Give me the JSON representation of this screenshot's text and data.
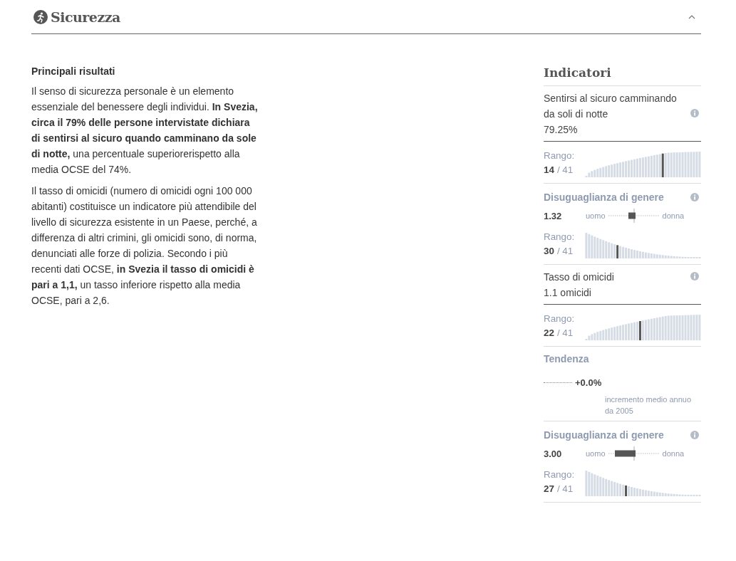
{
  "header": {
    "title": "Sicurezza",
    "expanded": true
  },
  "main": {
    "heading": "Principali risultati",
    "paragraphs": [
      "Il senso di sicurezza personale è un elemento essenziale del benessere degli individui. **In Svezia, circa il 79% delle persone intervistate dichiara di sentirsi al sicuro quando camminano da sole di notte,** una percentuale superiorerispetto alla media OCSE del 74%.",
      "Il tasso di omicidi (numero di omicidi ogni 100 000 abitanti) costituisce un indicatore più attendibile del livello di sicurezza esistente in un Paese, perché, a differenza di altri crimini, gli omicidi sono, di norma, denunciati alle forze di polizia. Secondo i più recenti dati OCSE, **in Svezia il tasso di omicidi è pari a 1,1,** un tasso inferiore rispetto alla media OCSE, pari a 2,6."
    ]
  },
  "sidebar": {
    "title": "Indicatori",
    "blocks": [
      {
        "kind": "indicator",
        "label": "Sentirsi al sicuro camminando da soli di notte",
        "value": "79.25%"
      },
      {
        "kind": "rank-ascending",
        "label": "Rango:",
        "rank": "14",
        "total": "/ 41",
        "level": 0.67
      },
      {
        "kind": "gender",
        "label": "Disuguaglianza di genere",
        "value": "1.32",
        "left": "uomo",
        "right": "donna"
      },
      {
        "kind": "rank-descending",
        "label": "Rango:",
        "rank": "30",
        "total": "/ 41",
        "level": 0.27
      },
      {
        "kind": "indicator",
        "label": "Tasso di omicidi",
        "value": "1.1 omicidi"
      },
      {
        "kind": "rank-ascending",
        "label": "Rango:",
        "rank": "22",
        "total": "/ 41",
        "level": 0.47
      },
      {
        "kind": "trend",
        "label": "Tendenza",
        "value": "+0.0%",
        "note": "incremento medio annuo da 2005"
      },
      {
        "kind": "gender",
        "label": "Disuguaglianza di genere",
        "value": "3.00",
        "left": "uomo",
        "right": "donna"
      },
      {
        "kind": "rank-descending",
        "label": "Rango:",
        "rank": "27",
        "total": "/ 41",
        "level": 0.35
      }
    ]
  }
}
